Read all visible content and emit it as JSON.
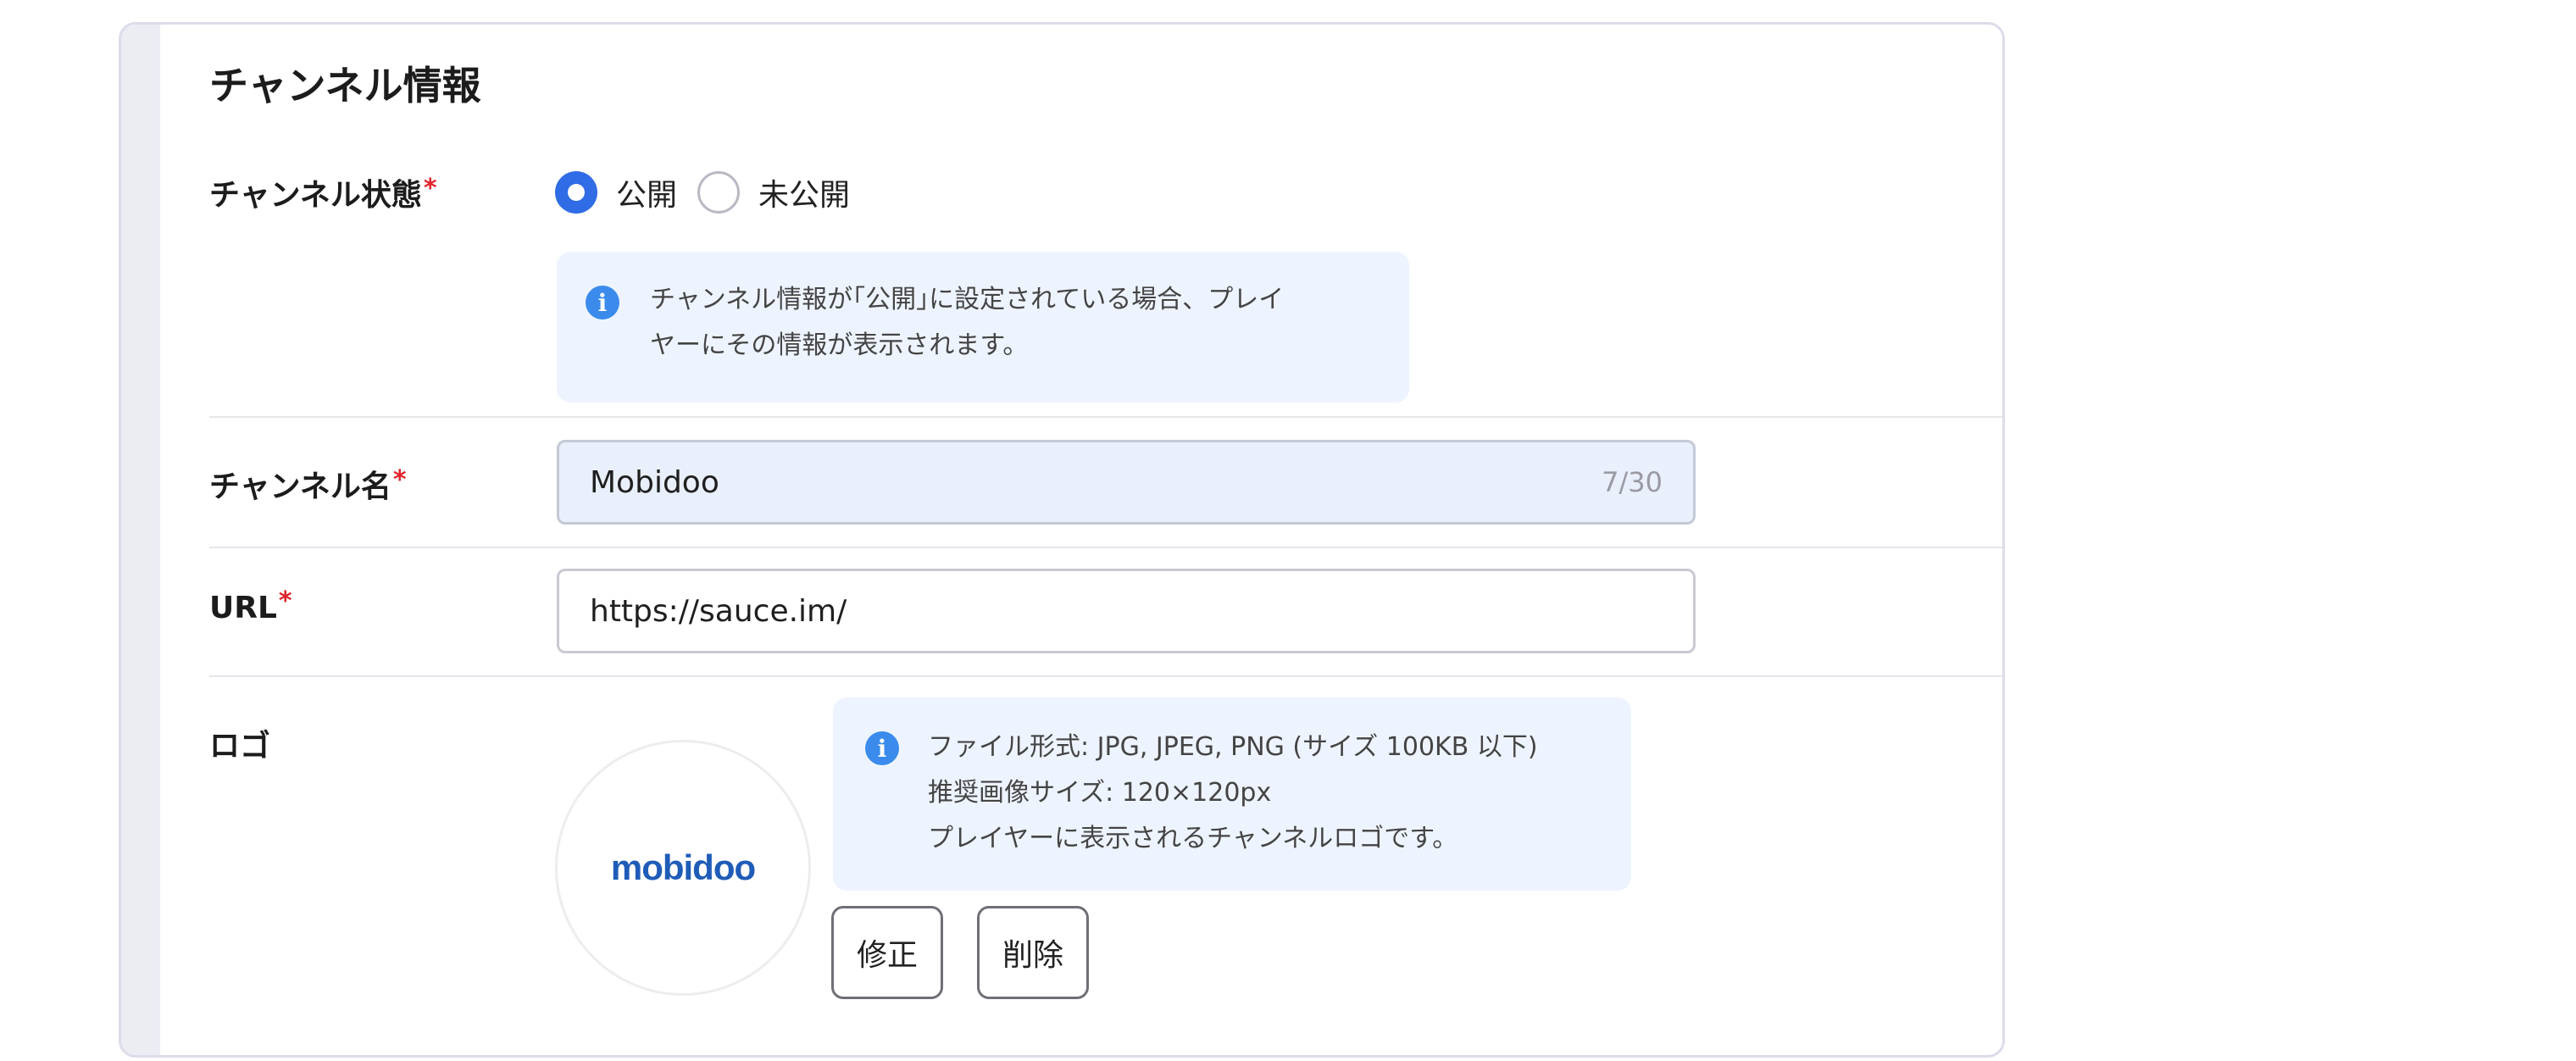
{
  "section": {
    "title": "チャンネル情報"
  },
  "status": {
    "label": "チャンネル状態",
    "required_mark": "*",
    "options": [
      {
        "label": "公開",
        "selected": true
      },
      {
        "label": "未公開",
        "selected": false
      }
    ],
    "info_lines": [
      "チャンネル情報が｢公開｣に設定されている場合、プレイ",
      "ヤーにその情報が表示されます。"
    ]
  },
  "channel_name": {
    "label": "チャンネル名",
    "required_mark": "*",
    "value": "Mobidoo",
    "counter": "7/30"
  },
  "url": {
    "label": "URL",
    "required_mark": "*",
    "value": "https://sauce.im/"
  },
  "logo": {
    "label": "ロゴ",
    "image_text": "mobidoo",
    "info_lines": [
      "ファイル形式: JPG, JPEG, PNG (サイズ 100KB 以下)",
      "推奨画像サイズ: 120×120px",
      "プレイヤーに表示されるチャンネルロゴです。"
    ],
    "edit_button": "修正",
    "delete_button": "削除"
  },
  "colors": {
    "accent": "#2f6ce5",
    "info_icon": "#3a8bec",
    "required": "#e0242c",
    "info_background": "#eef4ff",
    "logo_text": "#1f5cb8"
  },
  "icons": {
    "info": "info-circle-icon"
  }
}
